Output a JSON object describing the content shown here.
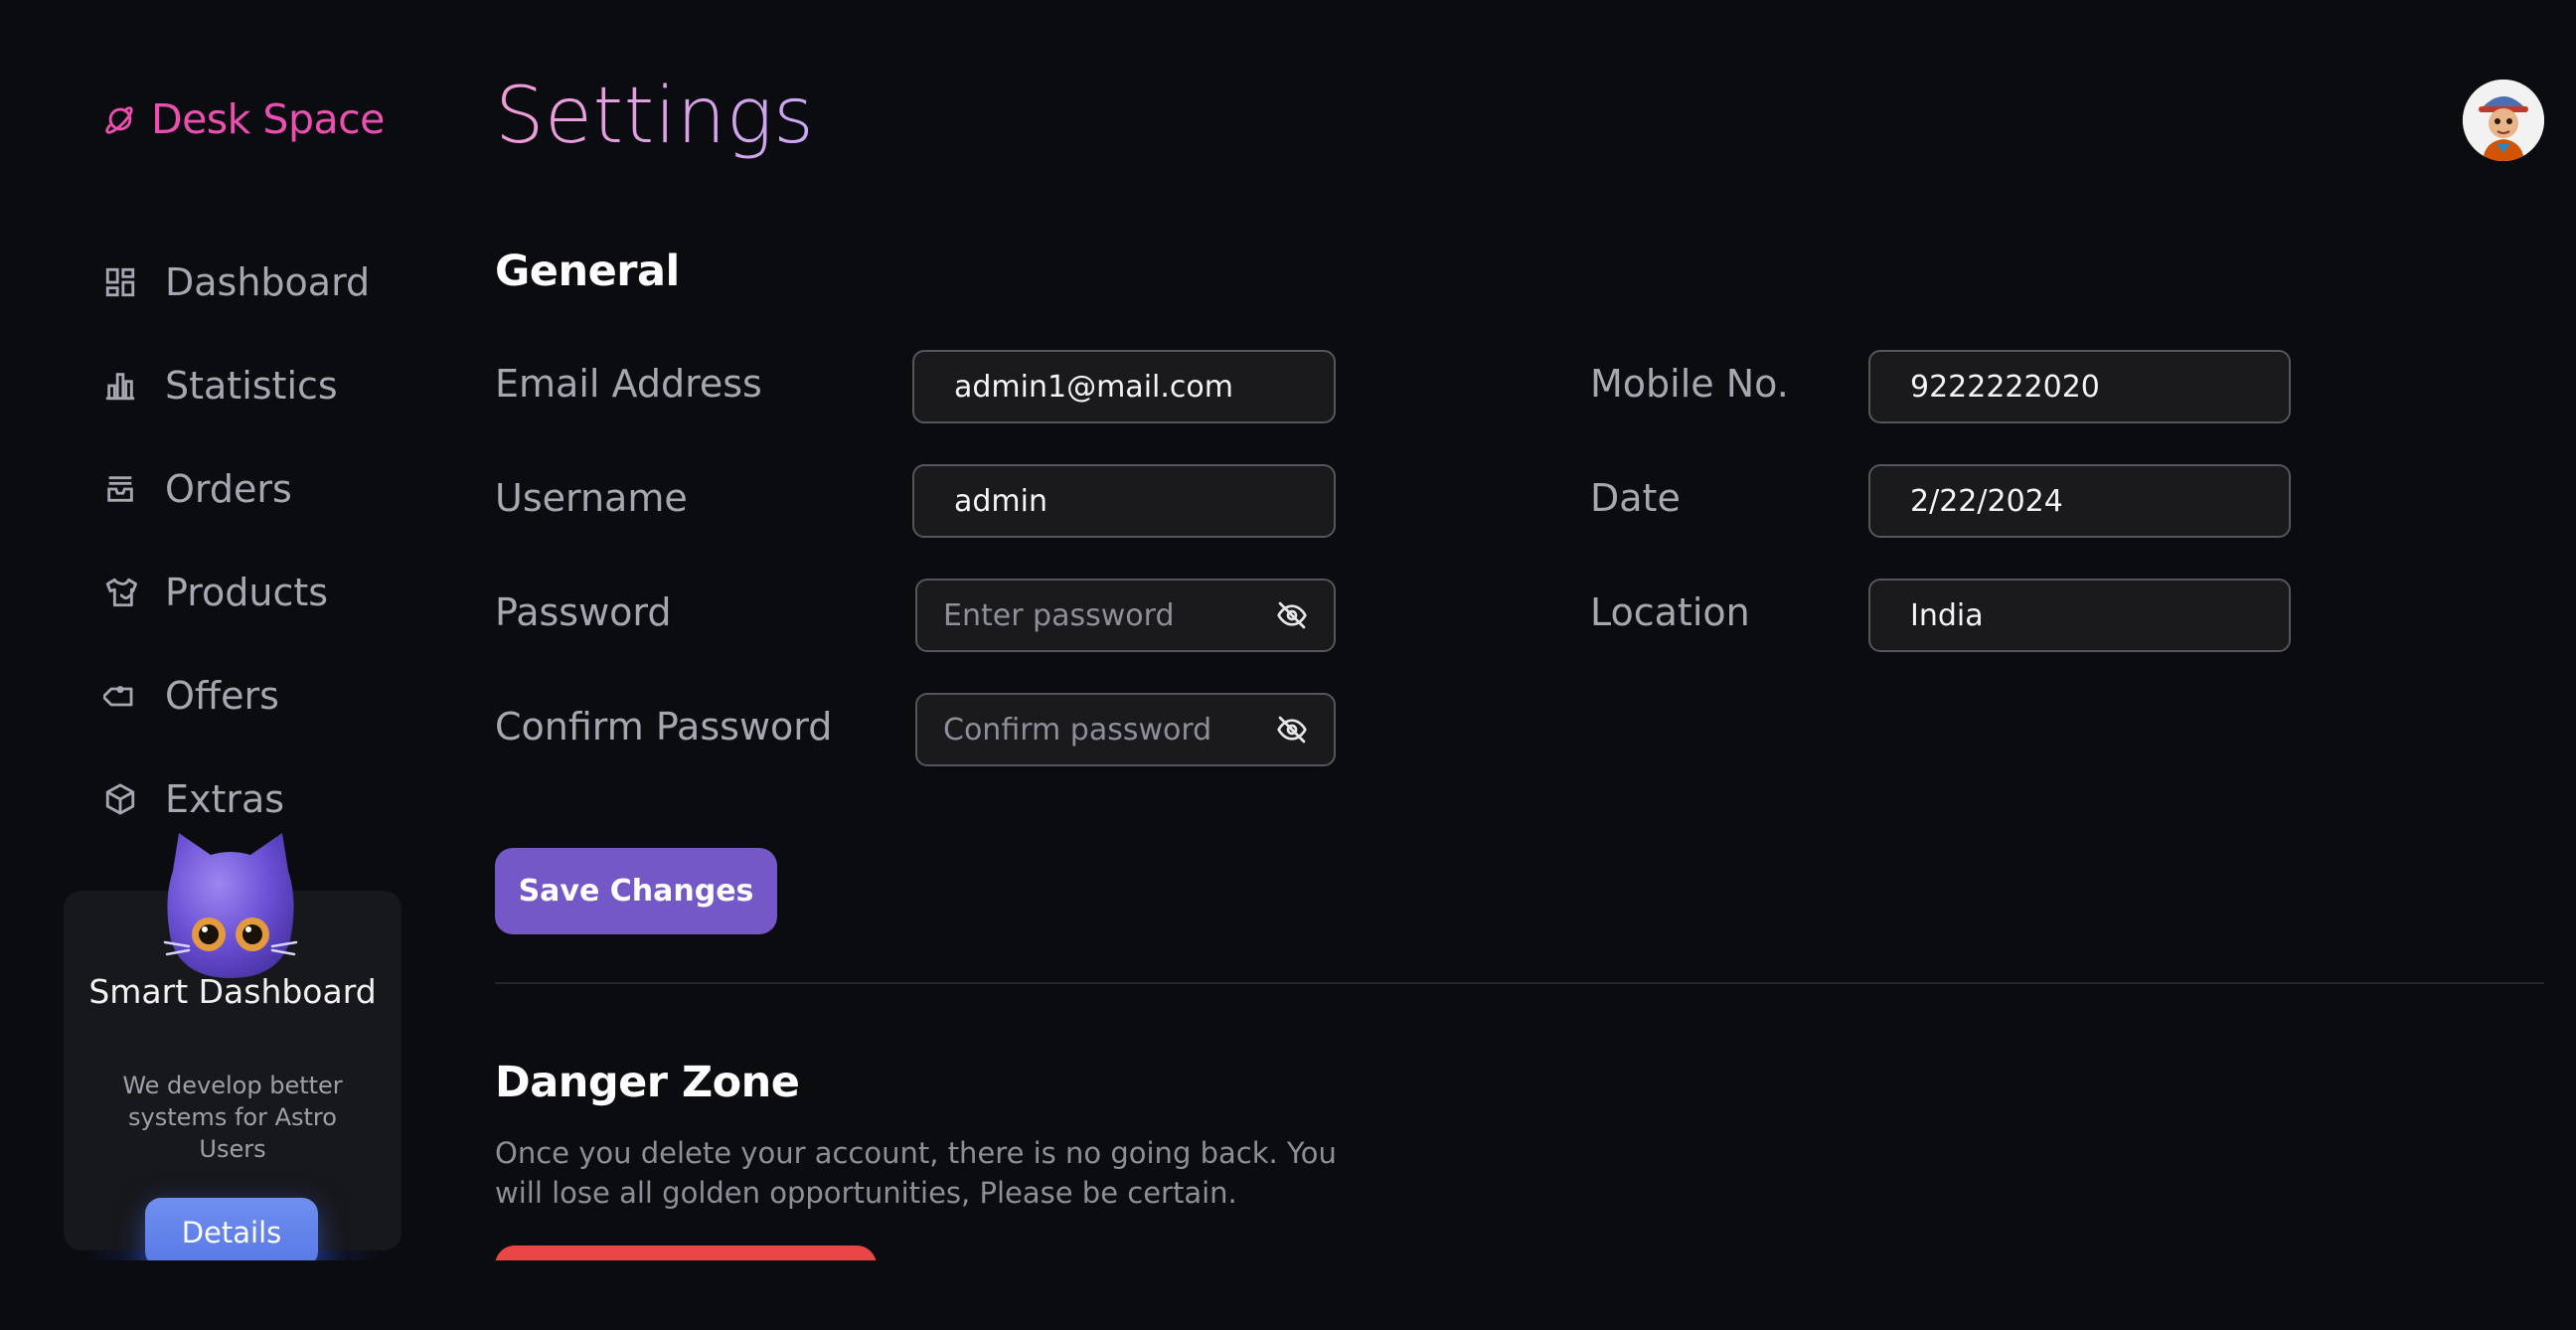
{
  "app": {
    "brand": "Desk Space",
    "page_title": "Settings"
  },
  "sidebar": {
    "items": [
      {
        "label": "Dashboard",
        "icon": "dashboard-icon"
      },
      {
        "label": "Statistics",
        "icon": "bar-chart-icon"
      },
      {
        "label": "Orders",
        "icon": "inbox-icon"
      },
      {
        "label": "Products",
        "icon": "shirt-icon"
      },
      {
        "label": "Offers",
        "icon": "tag-icon"
      },
      {
        "label": "Extras",
        "icon": "cube-icon"
      }
    ],
    "promo": {
      "title": "Smart Dashboard",
      "description": "We develop better systems for Astro Users",
      "button_label": "Details"
    }
  },
  "general": {
    "title": "General",
    "email_label": "Email Address",
    "email_value": "admin1@mail.com",
    "username_label": "Username",
    "username_value": "admin",
    "password_label": "Password",
    "password_placeholder": "Enter password",
    "confirm_label": "Confirm Password",
    "confirm_placeholder": "Confirm password",
    "mobile_label": "Mobile No.",
    "mobile_value": "9222222020",
    "date_label": "Date",
    "date_value": "2/22/2024",
    "location_label": "Location",
    "location_value": "India",
    "save_label": "Save Changes"
  },
  "danger": {
    "title": "Danger Zone",
    "description": "Once you delete your account, there is no going back. You will lose all golden opportunities, Please be certain."
  },
  "colors": {
    "background": "#0b0c10",
    "brand": "#ec4fb0",
    "primary_button": "#7558c8",
    "details_button": "#5f80ea",
    "danger": "#ea4645"
  }
}
